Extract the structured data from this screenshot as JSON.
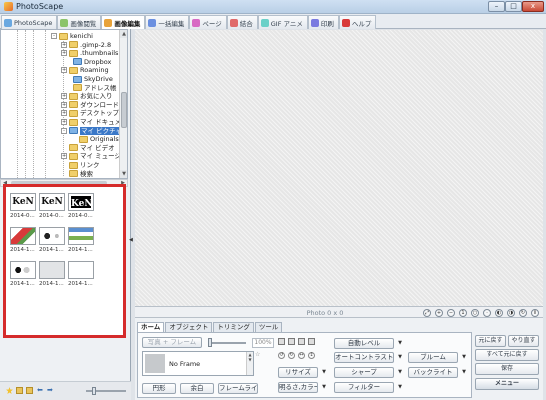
{
  "window": {
    "title": "PhotoScape",
    "minimize": "–",
    "maximize": "□",
    "close": "x"
  },
  "tabs": [
    {
      "label": "PhotoScape",
      "color": "#6aa8e0"
    },
    {
      "label": "画像閲覧",
      "color": "#8cc46a"
    },
    {
      "label": "画像編集",
      "color": "#e8a33a"
    },
    {
      "label": "一括編集",
      "color": "#6a8fe0"
    },
    {
      "label": "ページ",
      "color": "#d86ac4"
    },
    {
      "label": "結合",
      "color": "#e06a6a"
    },
    {
      "label": "GIF アニメ",
      "color": "#6ad0c8"
    },
    {
      "label": "印刷",
      "color": "#7a7ae0"
    },
    {
      "label": "ヘルプ",
      "color": "#d83a3a"
    }
  ],
  "active_tab": "画像編集",
  "tree": {
    "items": [
      {
        "label": "kenichi",
        "expander": "-",
        "folder": "yellow"
      },
      {
        "label": ".gimp-2.8",
        "expander": "+",
        "folder": "yellow"
      },
      {
        "label": ".thumbnails",
        "expander": "+",
        "folder": "yellow"
      },
      {
        "label": "Dropbox",
        "expander": "",
        "folder": "blue"
      },
      {
        "label": "Roaming",
        "expander": "+",
        "folder": "yellow"
      },
      {
        "label": "SkyDrive",
        "expander": "",
        "folder": "blue"
      },
      {
        "label": "アドレス帳",
        "expander": "",
        "folder": "yellow"
      },
      {
        "label": "お気に入り",
        "expander": "+",
        "folder": "yellow"
      },
      {
        "label": "ダウンロード",
        "expander": "+",
        "folder": "yellow"
      },
      {
        "label": "デスクトップ",
        "expander": "+",
        "folder": "yellow"
      },
      {
        "label": "マイ ドキュメン",
        "expander": "+",
        "folder": "yellow"
      },
      {
        "label": "マイ ピクチャ",
        "expander": "-",
        "folder": "blue",
        "selected": true
      },
      {
        "label": "Originals",
        "expander": "",
        "folder": "yellow"
      },
      {
        "label": "マイ ビデオ",
        "expander": "",
        "folder": "yellow"
      },
      {
        "label": "マイ ミュージッ",
        "expander": "+",
        "folder": "yellow"
      },
      {
        "label": "リンク",
        "expander": "",
        "folder": "yellow"
      },
      {
        "label": "検索",
        "expander": "",
        "folder": "yellow"
      }
    ]
  },
  "thumbnails": [
    {
      "caption": "2014-0...",
      "kind": "kv",
      "text": "KeN"
    },
    {
      "caption": "2014-0...",
      "kind": "kv",
      "text": "KeN"
    },
    {
      "caption": "2014-0...",
      "kind": "kv-dark",
      "text": "KeN"
    },
    {
      "caption": "2014-1...",
      "kind": "red"
    },
    {
      "caption": "2014-1...",
      "kind": "dots"
    },
    {
      "caption": "2014-1...",
      "kind": "screen"
    },
    {
      "caption": "2014-1...",
      "kind": "dots2"
    },
    {
      "caption": "2014-1...",
      "kind": "gray"
    },
    {
      "caption": "2014-1...",
      "kind": "blank"
    }
  ],
  "status": {
    "photo_info": "Photo 0 x 0"
  },
  "edit_tabs": [
    "ホーム",
    "オブジェクト",
    "トリミング",
    "ツール"
  ],
  "active_edit_tab": "ホーム",
  "home": {
    "photo_frame": "写真 + フレーム",
    "frame_pct": "100%",
    "frame_name": "No Frame",
    "circle": "円形",
    "margin": "余白",
    "frame_line": "フレームライン",
    "resize": "リサイズ",
    "brightness_color": "明るさ,カラー",
    "auto_level": "自動レベル",
    "auto_contrast": "オートコントラスト",
    "sharpen": "シャープ",
    "filter": "フィルター",
    "bloom": "ブルーム",
    "backlight": "バックライト"
  },
  "right_actions": {
    "undo_original": "元に戻す",
    "redo": "やり直す",
    "undo_all": "すべて元に戻す",
    "save": "保存",
    "menu": "メニュー"
  }
}
